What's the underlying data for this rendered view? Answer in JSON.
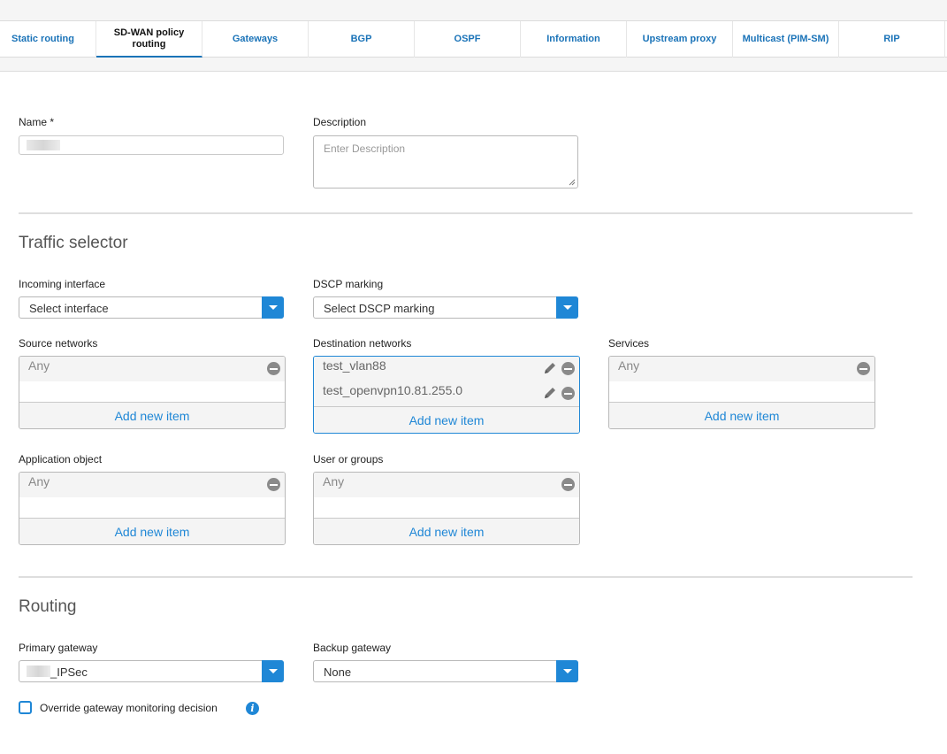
{
  "tabs": [
    {
      "label": "Static routing"
    },
    {
      "label": "SD-WAN policy routing"
    },
    {
      "label": "Gateways"
    },
    {
      "label": "BGP"
    },
    {
      "label": "OSPF"
    },
    {
      "label": "Information"
    },
    {
      "label": "Upstream proxy"
    },
    {
      "label": "Multicast (PIM-SM)"
    },
    {
      "label": "RIP"
    }
  ],
  "active_tab": "SD-WAN policy routing",
  "form": {
    "name_label": "Name *",
    "description_label": "Description",
    "description_placeholder": "Enter Description"
  },
  "traffic_selector": {
    "title": "Traffic selector",
    "incoming_interface": {
      "label": "Incoming interface",
      "value": "Select interface"
    },
    "dscp_marking": {
      "label": "DSCP marking",
      "value": "Select DSCP marking"
    },
    "source_networks": {
      "label": "Source networks",
      "items": [
        "Any"
      ],
      "add_label": "Add new item"
    },
    "destination_networks": {
      "label": "Destination networks",
      "items": [
        "test_vlan88",
        "test_openvpn10.81.255.0"
      ],
      "add_label": "Add new item"
    },
    "services": {
      "label": "Services",
      "items": [
        "Any"
      ],
      "add_label": "Add new item"
    },
    "application_object": {
      "label": "Application object",
      "items": [
        "Any"
      ],
      "add_label": "Add new item"
    },
    "user_or_groups": {
      "label": "User or groups",
      "items": [
        "Any"
      ],
      "add_label": "Add new item"
    }
  },
  "routing": {
    "title": "Routing",
    "primary_gateway": {
      "label": "Primary gateway",
      "value": "_IPSec"
    },
    "backup_gateway": {
      "label": "Backup gateway",
      "value": "None"
    },
    "override_label": "Override gateway monitoring decision",
    "override_checked": false,
    "info_glyph": "i"
  },
  "colors": {
    "accent": "#1f87d6",
    "tab_text": "#1a73b8"
  },
  "icons": [
    "pencil-icon",
    "remove-icon",
    "chevron-down-icon",
    "info-icon"
  ]
}
